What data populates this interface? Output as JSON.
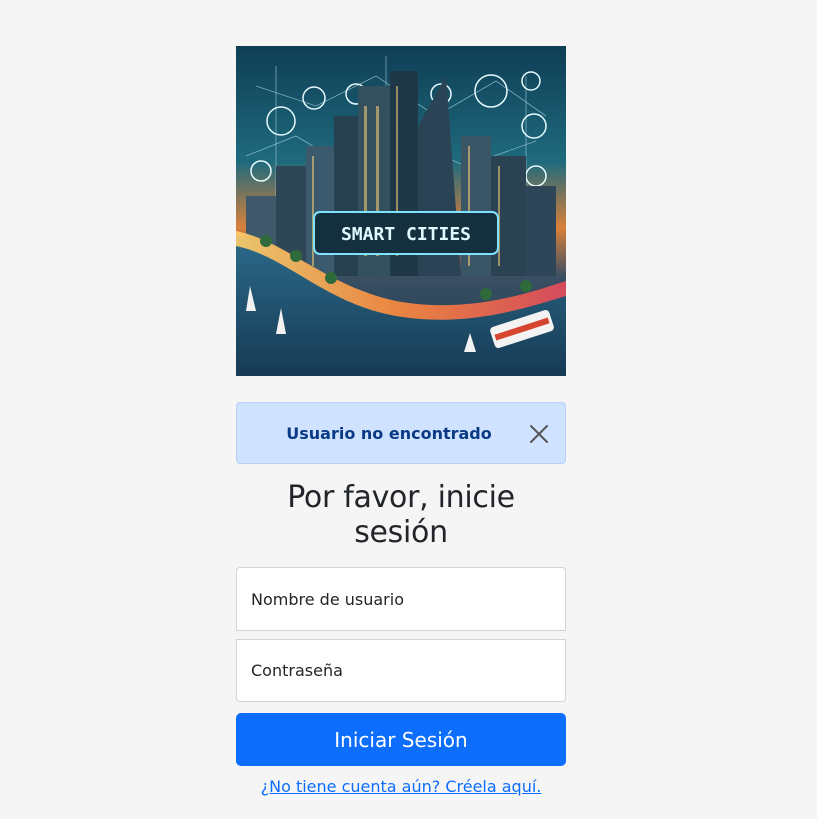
{
  "hero": {
    "caption": "SMART CITIES",
    "icon": "smart-city-illustration"
  },
  "alert": {
    "message": "Usuario no encontrado",
    "close_icon": "close-icon",
    "color": "#0a3a86",
    "background": "#cfe2ff"
  },
  "form": {
    "title": "Por favor, inicie sesión",
    "username_placeholder": "Nombre de usuario",
    "password_placeholder": "Contraseña",
    "submit_label": "Iniciar Sesión",
    "register_link": "¿No tiene cuenta aún? Créela aquí."
  },
  "colors": {
    "primary": "#0d6efd",
    "page_background": "#f5f5f5"
  }
}
